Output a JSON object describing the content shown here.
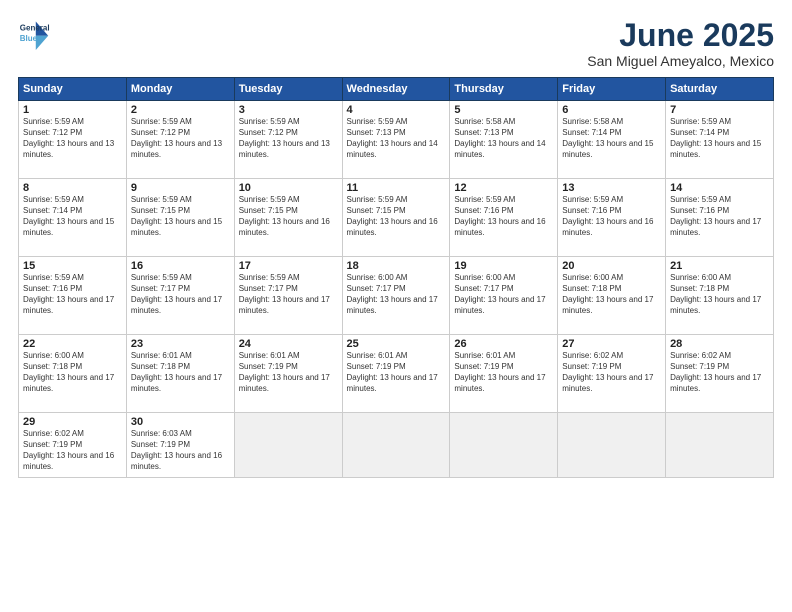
{
  "logo": {
    "line1": "General",
    "line2": "Blue"
  },
  "title": "June 2025",
  "subtitle": "San Miguel Ameyalco, Mexico",
  "weekdays": [
    "Sunday",
    "Monday",
    "Tuesday",
    "Wednesday",
    "Thursday",
    "Friday",
    "Saturday"
  ],
  "weeks": [
    [
      {
        "day": "1",
        "sunrise": "Sunrise: 5:59 AM",
        "sunset": "Sunset: 7:12 PM",
        "daylight": "Daylight: 13 hours and 13 minutes."
      },
      {
        "day": "2",
        "sunrise": "Sunrise: 5:59 AM",
        "sunset": "Sunset: 7:12 PM",
        "daylight": "Daylight: 13 hours and 13 minutes."
      },
      {
        "day": "3",
        "sunrise": "Sunrise: 5:59 AM",
        "sunset": "Sunset: 7:12 PM",
        "daylight": "Daylight: 13 hours and 13 minutes."
      },
      {
        "day": "4",
        "sunrise": "Sunrise: 5:59 AM",
        "sunset": "Sunset: 7:13 PM",
        "daylight": "Daylight: 13 hours and 14 minutes."
      },
      {
        "day": "5",
        "sunrise": "Sunrise: 5:58 AM",
        "sunset": "Sunset: 7:13 PM",
        "daylight": "Daylight: 13 hours and 14 minutes."
      },
      {
        "day": "6",
        "sunrise": "Sunrise: 5:58 AM",
        "sunset": "Sunset: 7:14 PM",
        "daylight": "Daylight: 13 hours and 15 minutes."
      },
      {
        "day": "7",
        "sunrise": "Sunrise: 5:59 AM",
        "sunset": "Sunset: 7:14 PM",
        "daylight": "Daylight: 13 hours and 15 minutes."
      }
    ],
    [
      {
        "day": "8",
        "sunrise": "Sunrise: 5:59 AM",
        "sunset": "Sunset: 7:14 PM",
        "daylight": "Daylight: 13 hours and 15 minutes."
      },
      {
        "day": "9",
        "sunrise": "Sunrise: 5:59 AM",
        "sunset": "Sunset: 7:15 PM",
        "daylight": "Daylight: 13 hours and 15 minutes."
      },
      {
        "day": "10",
        "sunrise": "Sunrise: 5:59 AM",
        "sunset": "Sunset: 7:15 PM",
        "daylight": "Daylight: 13 hours and 16 minutes."
      },
      {
        "day": "11",
        "sunrise": "Sunrise: 5:59 AM",
        "sunset": "Sunset: 7:15 PM",
        "daylight": "Daylight: 13 hours and 16 minutes."
      },
      {
        "day": "12",
        "sunrise": "Sunrise: 5:59 AM",
        "sunset": "Sunset: 7:16 PM",
        "daylight": "Daylight: 13 hours and 16 minutes."
      },
      {
        "day": "13",
        "sunrise": "Sunrise: 5:59 AM",
        "sunset": "Sunset: 7:16 PM",
        "daylight": "Daylight: 13 hours and 16 minutes."
      },
      {
        "day": "14",
        "sunrise": "Sunrise: 5:59 AM",
        "sunset": "Sunset: 7:16 PM",
        "daylight": "Daylight: 13 hours and 17 minutes."
      }
    ],
    [
      {
        "day": "15",
        "sunrise": "Sunrise: 5:59 AM",
        "sunset": "Sunset: 7:16 PM",
        "daylight": "Daylight: 13 hours and 17 minutes."
      },
      {
        "day": "16",
        "sunrise": "Sunrise: 5:59 AM",
        "sunset": "Sunset: 7:17 PM",
        "daylight": "Daylight: 13 hours and 17 minutes."
      },
      {
        "day": "17",
        "sunrise": "Sunrise: 5:59 AM",
        "sunset": "Sunset: 7:17 PM",
        "daylight": "Daylight: 13 hours and 17 minutes."
      },
      {
        "day": "18",
        "sunrise": "Sunrise: 6:00 AM",
        "sunset": "Sunset: 7:17 PM",
        "daylight": "Daylight: 13 hours and 17 minutes."
      },
      {
        "day": "19",
        "sunrise": "Sunrise: 6:00 AM",
        "sunset": "Sunset: 7:17 PM",
        "daylight": "Daylight: 13 hours and 17 minutes."
      },
      {
        "day": "20",
        "sunrise": "Sunrise: 6:00 AM",
        "sunset": "Sunset: 7:18 PM",
        "daylight": "Daylight: 13 hours and 17 minutes."
      },
      {
        "day": "21",
        "sunrise": "Sunrise: 6:00 AM",
        "sunset": "Sunset: 7:18 PM",
        "daylight": "Daylight: 13 hours and 17 minutes."
      }
    ],
    [
      {
        "day": "22",
        "sunrise": "Sunrise: 6:00 AM",
        "sunset": "Sunset: 7:18 PM",
        "daylight": "Daylight: 13 hours and 17 minutes."
      },
      {
        "day": "23",
        "sunrise": "Sunrise: 6:01 AM",
        "sunset": "Sunset: 7:18 PM",
        "daylight": "Daylight: 13 hours and 17 minutes."
      },
      {
        "day": "24",
        "sunrise": "Sunrise: 6:01 AM",
        "sunset": "Sunset: 7:19 PM",
        "daylight": "Daylight: 13 hours and 17 minutes."
      },
      {
        "day": "25",
        "sunrise": "Sunrise: 6:01 AM",
        "sunset": "Sunset: 7:19 PM",
        "daylight": "Daylight: 13 hours and 17 minutes."
      },
      {
        "day": "26",
        "sunrise": "Sunrise: 6:01 AM",
        "sunset": "Sunset: 7:19 PM",
        "daylight": "Daylight: 13 hours and 17 minutes."
      },
      {
        "day": "27",
        "sunrise": "Sunrise: 6:02 AM",
        "sunset": "Sunset: 7:19 PM",
        "daylight": "Daylight: 13 hours and 17 minutes."
      },
      {
        "day": "28",
        "sunrise": "Sunrise: 6:02 AM",
        "sunset": "Sunset: 7:19 PM",
        "daylight": "Daylight: 13 hours and 17 minutes."
      }
    ],
    [
      {
        "day": "29",
        "sunrise": "Sunrise: 6:02 AM",
        "sunset": "Sunset: 7:19 PM",
        "daylight": "Daylight: 13 hours and 16 minutes."
      },
      {
        "day": "30",
        "sunrise": "Sunrise: 6:03 AM",
        "sunset": "Sunset: 7:19 PM",
        "daylight": "Daylight: 13 hours and 16 minutes."
      },
      {
        "day": "",
        "sunrise": "",
        "sunset": "",
        "daylight": ""
      },
      {
        "day": "",
        "sunrise": "",
        "sunset": "",
        "daylight": ""
      },
      {
        "day": "",
        "sunrise": "",
        "sunset": "",
        "daylight": ""
      },
      {
        "day": "",
        "sunrise": "",
        "sunset": "",
        "daylight": ""
      },
      {
        "day": "",
        "sunrise": "",
        "sunset": "",
        "daylight": ""
      }
    ]
  ]
}
